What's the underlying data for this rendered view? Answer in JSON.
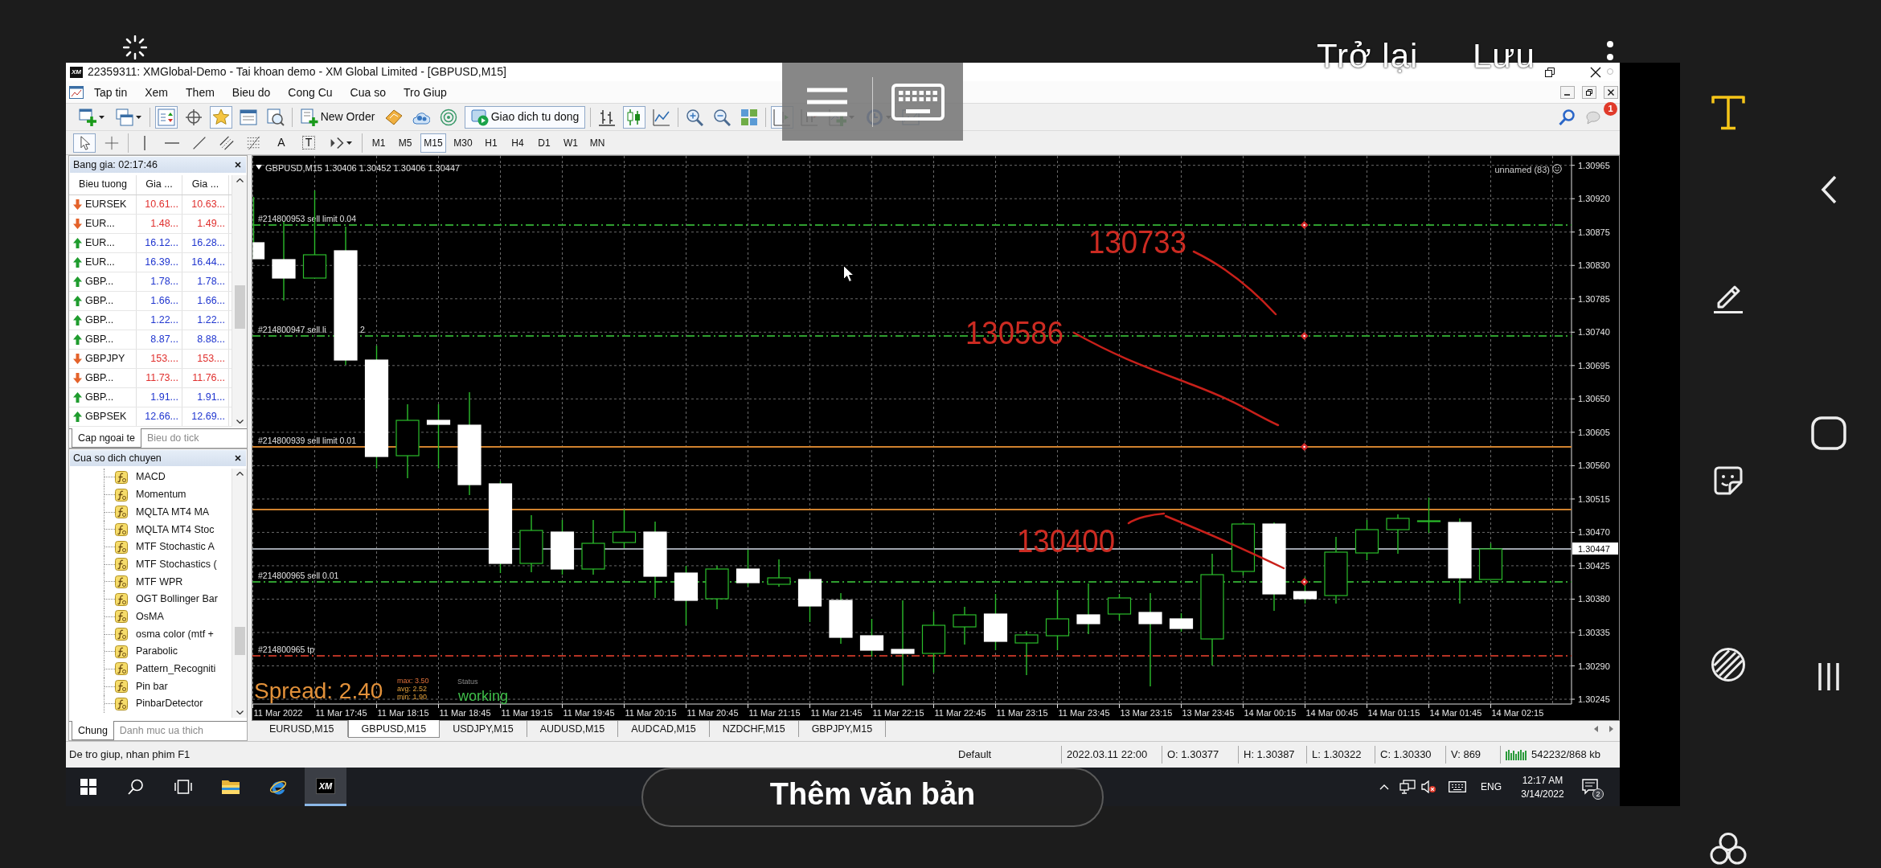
{
  "phone": {
    "back": "Trở lại",
    "save": "Lưu",
    "add_text": "Thêm văn bản",
    "tools": [
      {
        "selected": true
      },
      {
        "selected": false
      },
      {
        "selected": false
      },
      {
        "selected": false
      },
      {
        "selected": false
      }
    ]
  },
  "window": {
    "icon": "XM",
    "title": "22359311: XMGlobal-Demo - Tai khoan demo - XM Global Limited - [GBPUSD,M15]"
  },
  "menu": [
    "Tap tin",
    "Xem",
    "Them",
    "Bieu do",
    "Cong Cu",
    "Cua so",
    "Tro Giup"
  ],
  "toolbar": [
    {
      "pressed": false
    },
    {
      "pressed": false
    },
    {
      "pressed": true
    },
    {
      "pressed": false
    },
    {
      "pressed": true
    },
    {
      "pressed": false
    },
    {
      "pressed": false
    },
    {
      "label": "New Order",
      "pressed": false
    },
    {
      "pressed": false
    },
    {
      "pressed": false
    },
    {
      "pressed": false
    },
    {
      "label": "Giao dich tu dong",
      "pressed": true
    },
    {
      "pressed": false
    },
    {
      "pressed": true
    },
    {
      "pressed": false
    },
    {
      "pressed": false
    },
    {
      "pressed": false
    },
    {
      "pressed": false
    },
    {
      "pressed": true
    },
    {
      "pressed": false
    },
    {
      "pressed": false
    },
    {
      "pressed": false
    },
    {
      "pressed": false
    }
  ],
  "notifications": {
    "count": "1"
  },
  "draw_tools": [
    {
      "pressed": true
    },
    {
      "pressed": false
    },
    {
      "pressed": false
    },
    {
      "pressed": false
    },
    {
      "pressed": false
    },
    {
      "pressed": false
    },
    {
      "pressed": false
    },
    {
      "label": "A",
      "pressed": false
    },
    {
      "label": "T",
      "pressed": false
    },
    {
      "pressed": false
    }
  ],
  "timeframes": [
    {
      "label": "M1",
      "selected": false
    },
    {
      "label": "M5",
      "selected": false
    },
    {
      "label": "M15",
      "selected": true
    },
    {
      "label": "M30",
      "selected": false
    },
    {
      "label": "H1",
      "selected": false
    },
    {
      "label": "H4",
      "selected": false
    },
    {
      "label": "D1",
      "selected": false
    },
    {
      "label": "W1",
      "selected": false
    },
    {
      "label": "MN",
      "selected": false
    }
  ],
  "market_watch": {
    "title": "Bang gia: 02:17:46",
    "columns": [
      "Bieu tuong",
      "Gia ...",
      "Gia ..."
    ],
    "rows": [
      {
        "symbol": "EURSEK",
        "bid": "10.61...",
        "ask": "10.63...",
        "kind": "down"
      },
      {
        "symbol": "EUR...",
        "bid": "1.48...",
        "ask": "1.49...",
        "kind": "down"
      },
      {
        "symbol": "EUR...",
        "bid": "16.12...",
        "ask": "16.28...",
        "kind": "up"
      },
      {
        "symbol": "EUR...",
        "bid": "16.39...",
        "ask": "16.44...",
        "kind": "up"
      },
      {
        "symbol": "GBP...",
        "bid": "1.78...",
        "ask": "1.78...",
        "kind": "up"
      },
      {
        "symbol": "GBP...",
        "bid": "1.66...",
        "ask": "1.66...",
        "kind": "up"
      },
      {
        "symbol": "GBP...",
        "bid": "1.22...",
        "ask": "1.22...",
        "kind": "up"
      },
      {
        "symbol": "GBP...",
        "bid": "8.87...",
        "ask": "8.88...",
        "kind": "up"
      },
      {
        "symbol": "GBPJPY",
        "bid": "153....",
        "ask": "153....",
        "kind": "down"
      },
      {
        "symbol": "GBP...",
        "bid": "11.73...",
        "ask": "11.76...",
        "kind": "down"
      },
      {
        "symbol": "GBP...",
        "bid": "1.91...",
        "ask": "1.91...",
        "kind": "up"
      },
      {
        "symbol": "GBPSEK",
        "bid": "12.66...",
        "ask": "12.69...",
        "kind": "up"
      }
    ],
    "tabs": [
      {
        "label": "Cap ngoai te",
        "selected": true
      },
      {
        "label": "Bieu do tick",
        "selected": false
      }
    ]
  },
  "navigator": {
    "title": "Cua so dich chuyen",
    "items": [
      "MACD",
      "Momentum",
      "MQLTA MT4 MA",
      "MQLTA MT4 Stoc",
      "MTF Stochastic A",
      "MTF Stochastics (",
      "MTF WPR",
      "OGT Bollinger Bar",
      "OsMA",
      "osma color (mtf +",
      "Parabolic",
      "Pattern_Recogniti",
      "Pin bar",
      "PinbarDetector"
    ],
    "tabs": [
      {
        "label": "Chung",
        "selected": true
      },
      {
        "label": "Danh muc ua thich",
        "selected": false
      }
    ]
  },
  "chart": {
    "header": "GBPUSD,M15 1.30406 1.30452 1.30406 1.30447",
    "template": "unnamed (83)",
    "price_axis": [
      "1.30965",
      "1.30920",
      "1.30875",
      "1.30830",
      "1.30785",
      "1.30740",
      "1.30695",
      "1.30650",
      "1.30605",
      "1.30560",
      "1.30515",
      "1.30470",
      "1.30425",
      "1.30380",
      "1.30335",
      "1.30290",
      "1.30245"
    ],
    "current_price": "1.30447",
    "time_axis": [
      "11 Mar 2022",
      "11 Mar 17:45",
      "11 Mar 18:15",
      "11 Mar 18:45",
      "11 Mar 19:15",
      "11 Mar 19:45",
      "11 Mar 20:15",
      "11 Mar 20:45",
      "11 Mar 21:15",
      "11 Mar 21:45",
      "11 Mar 22:15",
      "11 Mar 22:45",
      "11 Mar 23:15",
      "11 Mar 23:45",
      "13 Mar 23:15",
      "13 Mar 23:45",
      "14 Mar 00:15",
      "14 Mar 00:45",
      "14 Mar 01:15",
      "14 Mar 01:45",
      "14 Mar 02:15"
    ],
    "price_lines": [
      {
        "label": "#214800953 sell limit 0.04",
        "color": "#2f9e2f",
        "kind": "dash-dot",
        "marker": true
      },
      {
        "label": "#214800947 sell li",
        "label_end": "2",
        "color": "#2f9e2f",
        "kind": "dash-dot",
        "marker": true
      },
      {
        "label": "#214800939 sell limit 0.01",
        "color": "#d0822e",
        "kind": "solid",
        "marker": true
      },
      {
        "color": "#d0822e",
        "kind": "solid",
        "marker": false
      },
      {
        "color": "#9ea4ac",
        "kind": "solid",
        "marker": false
      },
      {
        "label": "#214800965 sell 0.01",
        "color": "#2f9e2f",
        "kind": "dash-dot",
        "marker": true
      },
      {
        "label": "#214800965 tp",
        "color": "#b53324",
        "kind": "dash-dot",
        "marker": false
      }
    ],
    "annotations": [
      "130733",
      "130586",
      "130400"
    ],
    "spread": {
      "label": "Spread: 2.40",
      "stats": [
        "max: 3.50",
        "avg: 2.52",
        "min: 1.90"
      ],
      "status_label": "Status",
      "status": "working"
    }
  },
  "chart_tabs": [
    {
      "label": "EURUSD,M15",
      "selected": false
    },
    {
      "label": "GBPUSD,M15",
      "selected": true
    },
    {
      "label": "USDJPY,M15",
      "selected": false
    },
    {
      "label": "AUDUSD,M15",
      "selected": false
    },
    {
      "label": "AUDCAD,M15",
      "selected": false
    },
    {
      "label": "NZDCHF,M15",
      "selected": false
    },
    {
      "label": "GBPJPY,M15",
      "selected": false
    }
  ],
  "status_bar": {
    "help": "De tro giup, nhan phim F1",
    "profile": "Default",
    "datetime": "2022.03.11 22:00",
    "open": "O: 1.30377",
    "high": "H: 1.30387",
    "low": "L: 1.30322",
    "close": "C: 1.30330",
    "volume": "V: 869",
    "traffic": "542232/868 kb"
  },
  "taskbar": {
    "apps": [
      {
        "active": false
      },
      {
        "active": false
      },
      {
        "active": false
      },
      {
        "active": false
      },
      {
        "active": false
      },
      {
        "label": "XM",
        "active": true
      }
    ],
    "language": "ENG",
    "time": "12:17 AM",
    "date": "3/14/2022",
    "notifications": "2"
  }
}
